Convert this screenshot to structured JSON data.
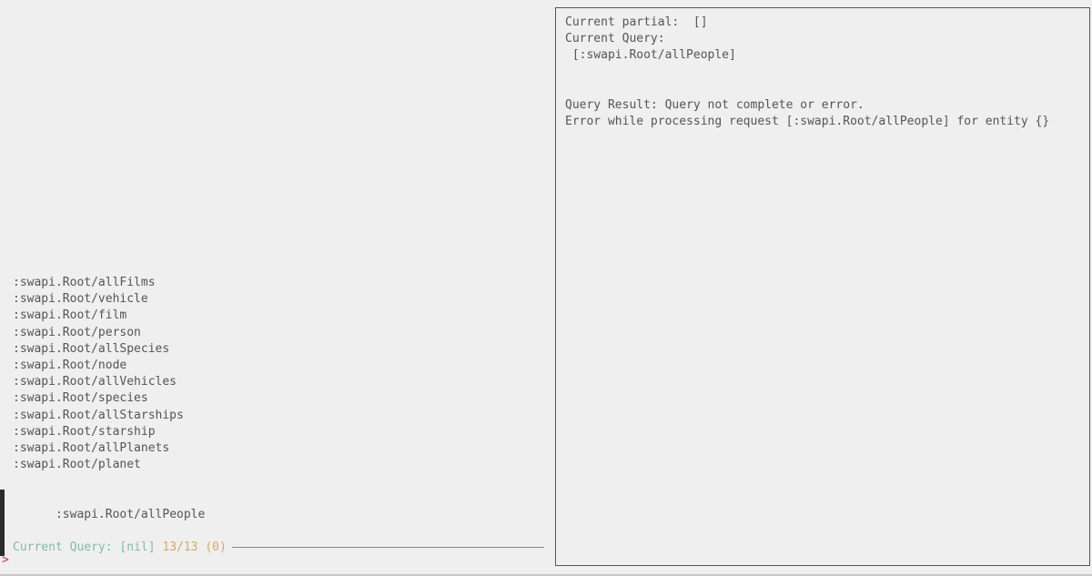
{
  "completions": {
    "items": [
      ":swapi.Root/allFilms",
      ":swapi.Root/vehicle",
      ":swapi.Root/film",
      ":swapi.Root/person",
      ":swapi.Root/allSpecies",
      ":swapi.Root/node",
      ":swapi.Root/allVehicles",
      ":swapi.Root/species",
      ":swapi.Root/allStarships",
      ":swapi.Root/starship",
      ":swapi.Root/allPlanets",
      ":swapi.Root/planet"
    ],
    "selected": ":swapi.Root/allPeople"
  },
  "status": {
    "current_query": "Current Query: [nil]",
    "counter": "13/13 (0)"
  },
  "prompt": ">",
  "result_pane": {
    "line1": "Current partial:  []",
    "line2": "Current Query:",
    "line3": " [:swapi.Root/allPeople]",
    "line4": "",
    "line5": "",
    "line6": "Query Result: Query not complete or error.",
    "line7": "Error while processing request [:swapi.Root/allPeople] for entity {}"
  }
}
